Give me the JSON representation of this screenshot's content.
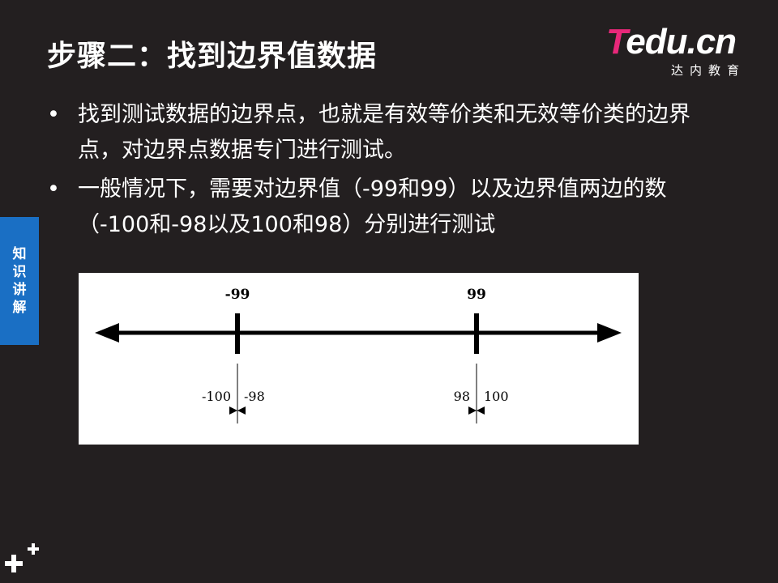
{
  "slide": {
    "title": "步骤二：找到边界值数据",
    "logo_tedu": "Tedu.cn",
    "logo_cn": "达内教育",
    "side_tab": [
      "知",
      "识",
      "讲",
      "解"
    ],
    "bullets": [
      "找到测试数据的边界点，也就是有效等价类和无效等价类的边界点，对边界点数据专门进行测试。",
      "一般情况下，需要对边界值（-99和99）以及边界值两边的数（-100和-98以及100和98）分别进行测试"
    ],
    "bullet_marker": "•"
  },
  "figure": {
    "left_boundary": "-99",
    "right_boundary": "99",
    "left_outside": "-100",
    "left_inside": "-98",
    "right_inside": "98",
    "right_outside": "100"
  }
}
